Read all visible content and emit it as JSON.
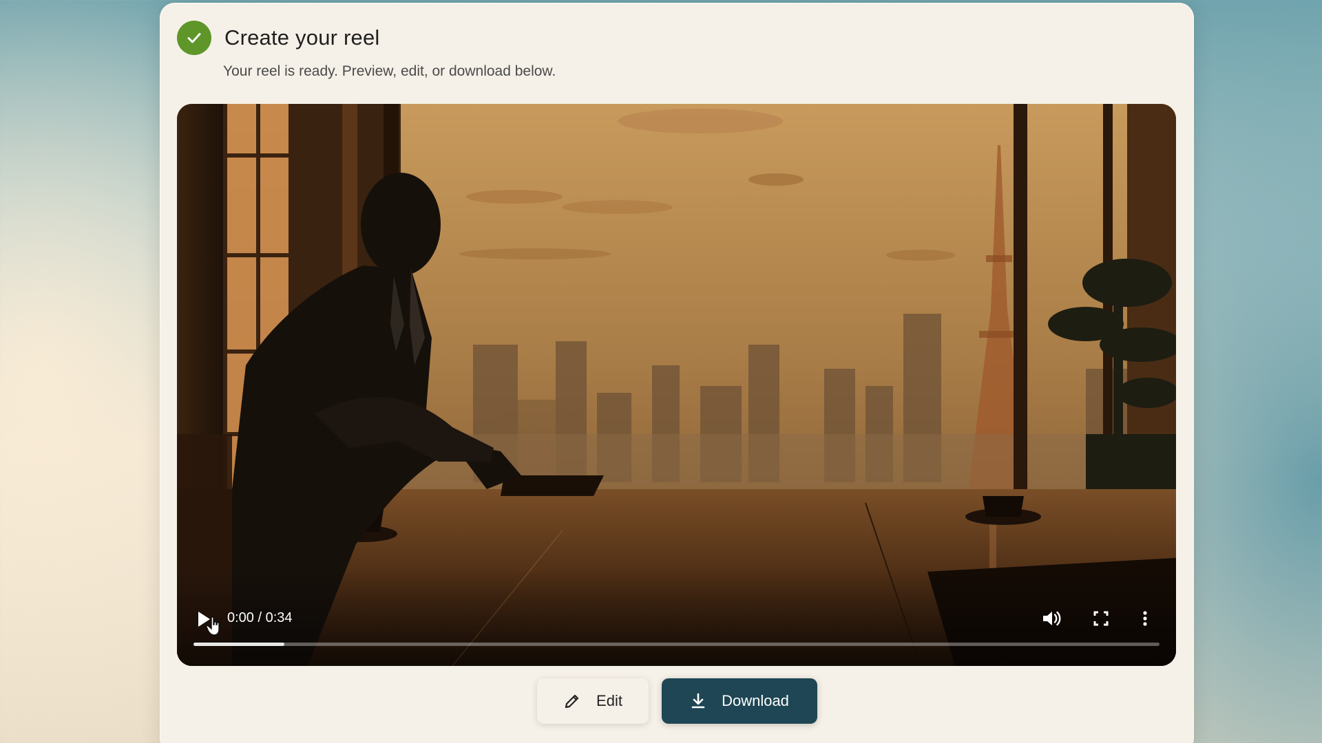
{
  "header": {
    "title": "Create your reel",
    "subtitle": "Your reel is ready. Preview, edit, or download below."
  },
  "player": {
    "time": "0:00 / 0:34",
    "progress_fraction": 0.094,
    "icons": [
      "play-icon",
      "volume-icon",
      "fullscreen-icon",
      "more-vertical-icon"
    ]
  },
  "actions": {
    "edit_label": "Edit",
    "download_label": "Download"
  },
  "colors": {
    "success": "#5e962a",
    "primary": "#1e4654",
    "card": "#f6f1e8"
  }
}
